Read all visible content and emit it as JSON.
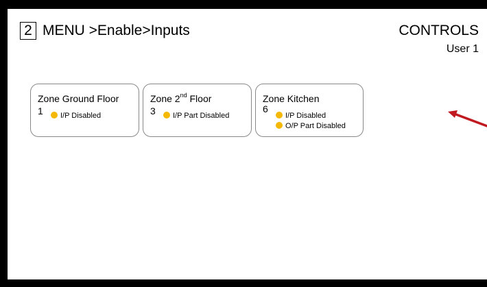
{
  "header": {
    "number": "2",
    "title": "MENU >Enable>Inputs",
    "controls_label": "CONTROLS",
    "user_label": "User 1"
  },
  "zones": [
    {
      "name_prefix": "Zone Ground Floor",
      "name_sup": "",
      "name_suffix": "",
      "number": "1",
      "statuses": [
        "I/P Disabled"
      ]
    },
    {
      "name_prefix": "Zone 2",
      "name_sup": "nd",
      "name_suffix": " Floor",
      "number": "3",
      "statuses": [
        "I/P Part Disabled"
      ]
    },
    {
      "name_prefix": "Zone Kitchen",
      "name_sup": "",
      "name_suffix": "",
      "number": "6",
      "statuses": [
        "I/P Disabled",
        "O/P Part Disabled"
      ]
    }
  ],
  "colors": {
    "status_dot": "#f5b800",
    "arrow": "#c0191f",
    "bezel": "#000000"
  },
  "icons": {
    "status": "status-dot-icon",
    "annotation": "red-arrow-icon"
  }
}
